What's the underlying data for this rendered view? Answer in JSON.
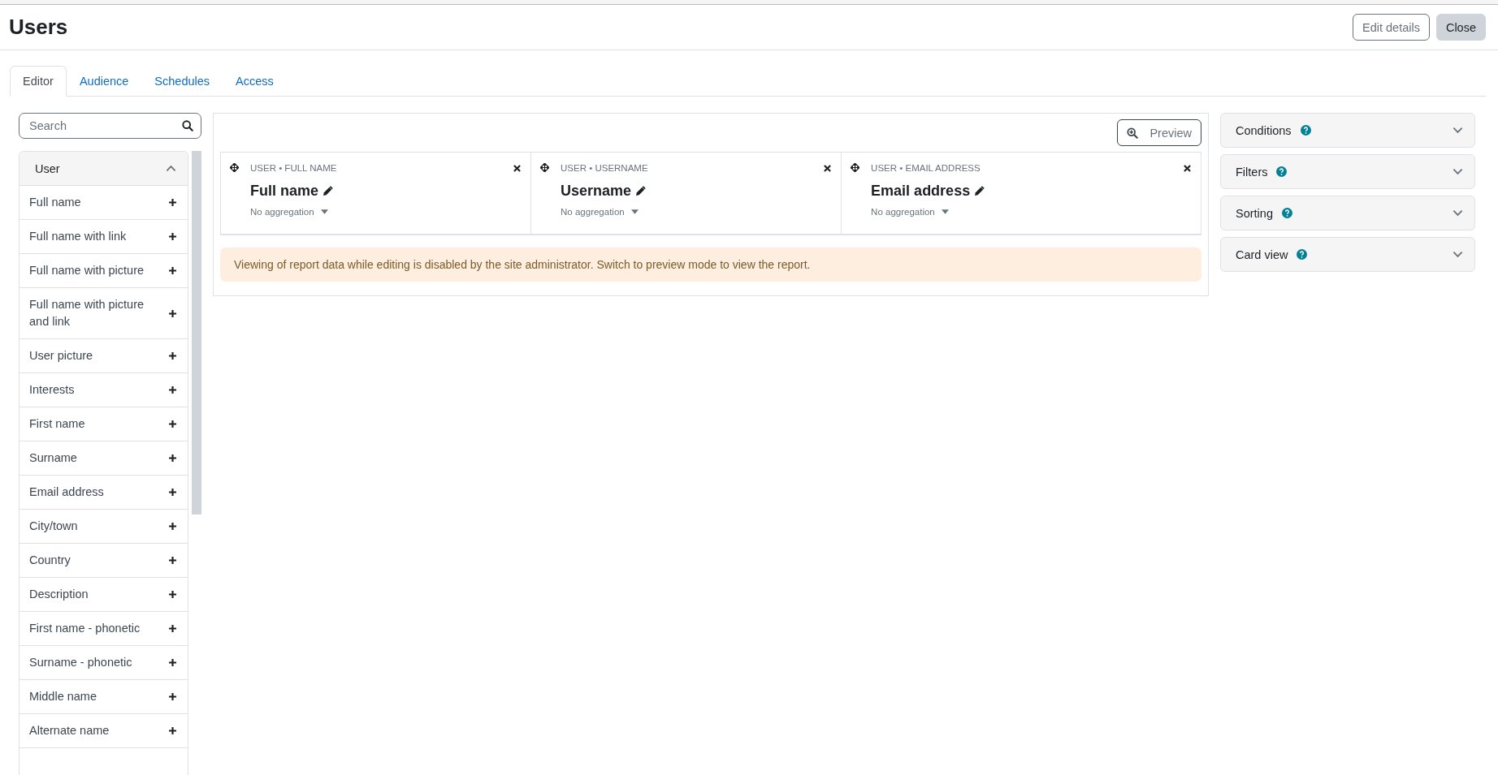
{
  "page": {
    "title": "Users"
  },
  "header_buttons": [
    {
      "label": "Edit details",
      "kind": "outline"
    },
    {
      "label": "Close",
      "kind": "secondary"
    }
  ],
  "tabs": [
    {
      "label": "Editor",
      "selected": true
    },
    {
      "label": "Audience",
      "selected": false
    },
    {
      "label": "Schedules",
      "selected": false
    },
    {
      "label": "Access",
      "selected": false
    }
  ],
  "sidebar": {
    "search": {
      "placeholder": "Search"
    },
    "section": {
      "title": "User",
      "expanded": true,
      "items": [
        {
          "label": "Full name"
        },
        {
          "label": "Full name with link"
        },
        {
          "label": "Full name with picture"
        },
        {
          "label": "Full name with picture and link"
        },
        {
          "label": "User picture"
        },
        {
          "label": "Interests"
        },
        {
          "label": "First name"
        },
        {
          "label": "Surname"
        },
        {
          "label": "Email address"
        },
        {
          "label": "City/town"
        },
        {
          "label": "Country"
        },
        {
          "label": "Description"
        },
        {
          "label": "First name - phonetic"
        },
        {
          "label": "Surname - phonetic"
        },
        {
          "label": "Middle name"
        },
        {
          "label": "Alternate name"
        }
      ]
    }
  },
  "report": {
    "preview_button": "Preview",
    "columns": [
      {
        "source": "USER • FULL NAME",
        "heading": "Full name",
        "aggregation": "No aggregation"
      },
      {
        "source": "USER • USERNAME",
        "heading": "Username",
        "aggregation": "No aggregation"
      },
      {
        "source": "USER • EMAIL ADDRESS",
        "heading": "Email address",
        "aggregation": "No aggregation"
      }
    ],
    "notice": "Viewing of report data while editing is disabled by the site administrator. Switch to preview mode to view the report."
  },
  "settings_panels": [
    {
      "title": "Conditions",
      "expanded": false
    },
    {
      "title": "Filters",
      "expanded": false
    },
    {
      "title": "Sorting",
      "expanded": false
    },
    {
      "title": "Card view",
      "expanded": false
    }
  ]
}
